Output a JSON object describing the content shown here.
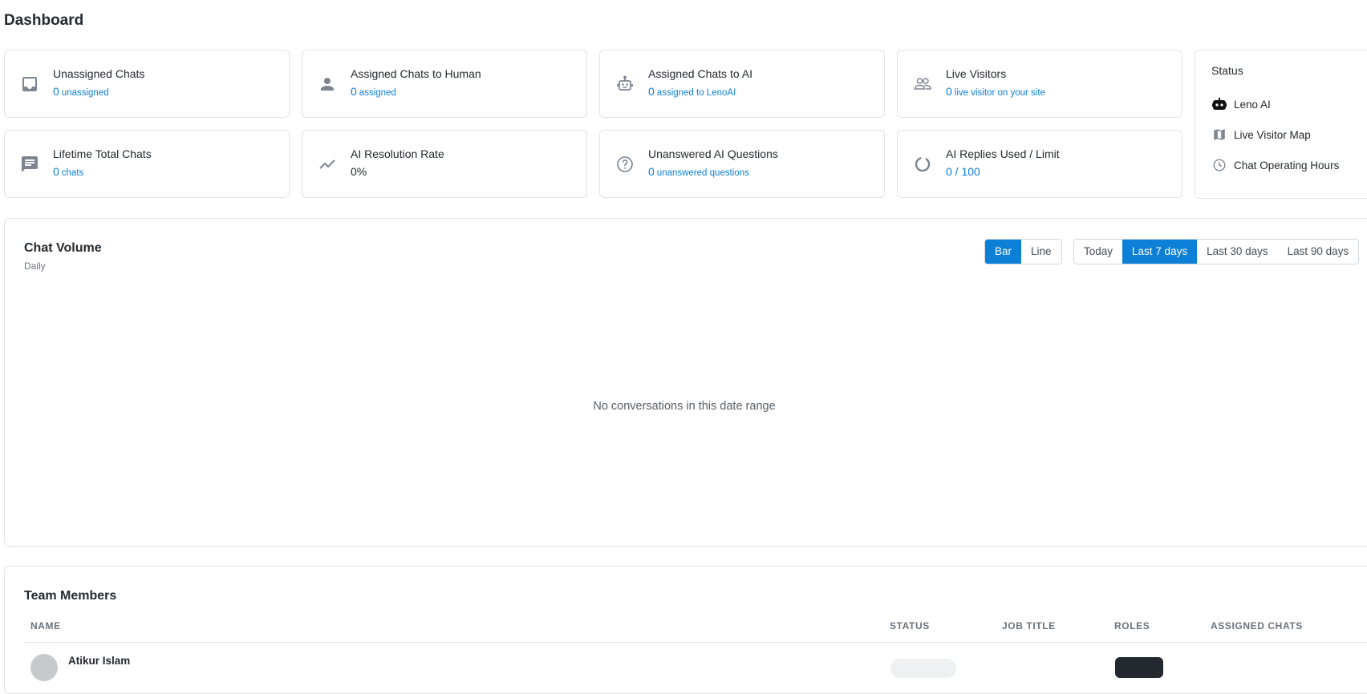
{
  "page": {
    "title": "Dashboard"
  },
  "stats": [
    {
      "title": "Unassigned Chats",
      "value": "0",
      "sub": "unassigned",
      "icon": "inbox-icon"
    },
    {
      "title": "Assigned Chats to Human",
      "value": "0",
      "sub": "assigned",
      "icon": "person-icon"
    },
    {
      "title": "Assigned Chats to AI",
      "value": "0",
      "sub": "assigned to LenoAI",
      "icon": "robot-icon"
    },
    {
      "title": "Live Visitors",
      "value": "0",
      "sub": "live visitor on your site",
      "icon": "people-icon"
    },
    {
      "title": "Lifetime Total Chats",
      "value": "0",
      "sub": "chats",
      "icon": "chat-icon"
    },
    {
      "title": "AI Resolution Rate",
      "value": "0%",
      "sub": "",
      "icon": "trend-icon"
    },
    {
      "title": "Unanswered AI Questions",
      "value": "0",
      "sub": "unanswered questions",
      "icon": "question-icon"
    },
    {
      "title": "AI Replies Used / Limit",
      "value": "0 / 100",
      "sub": "",
      "icon": "progress-ring-icon"
    }
  ],
  "status": {
    "title": "Status",
    "items": [
      {
        "label": "Leno AI",
        "icon": "bot-icon"
      },
      {
        "label": "Live Visitor Map",
        "icon": "map-icon"
      },
      {
        "label": "Chat Operating Hours",
        "icon": "clock-icon"
      }
    ]
  },
  "chart": {
    "title": "Chat Volume",
    "subtitle": "Daily",
    "chart_type_options": [
      "Bar",
      "Line"
    ],
    "chart_type_selected": "Bar",
    "range_options": [
      "Today",
      "Last 7 days",
      "Last 30 days",
      "Last 90 days"
    ],
    "range_selected": "Last 7 days",
    "empty_message": "No conversations in this date range"
  },
  "team": {
    "title": "Team Members",
    "columns": [
      "NAME",
      "STATUS",
      "JOB TITLE",
      "ROLES",
      "ASSIGNED CHATS"
    ],
    "rows": [
      {
        "name": "Atikur Islam"
      }
    ]
  },
  "colors": {
    "accent": "#0c7fd6",
    "border": "#e2e4e8",
    "icon_gray": "#7d8590"
  }
}
